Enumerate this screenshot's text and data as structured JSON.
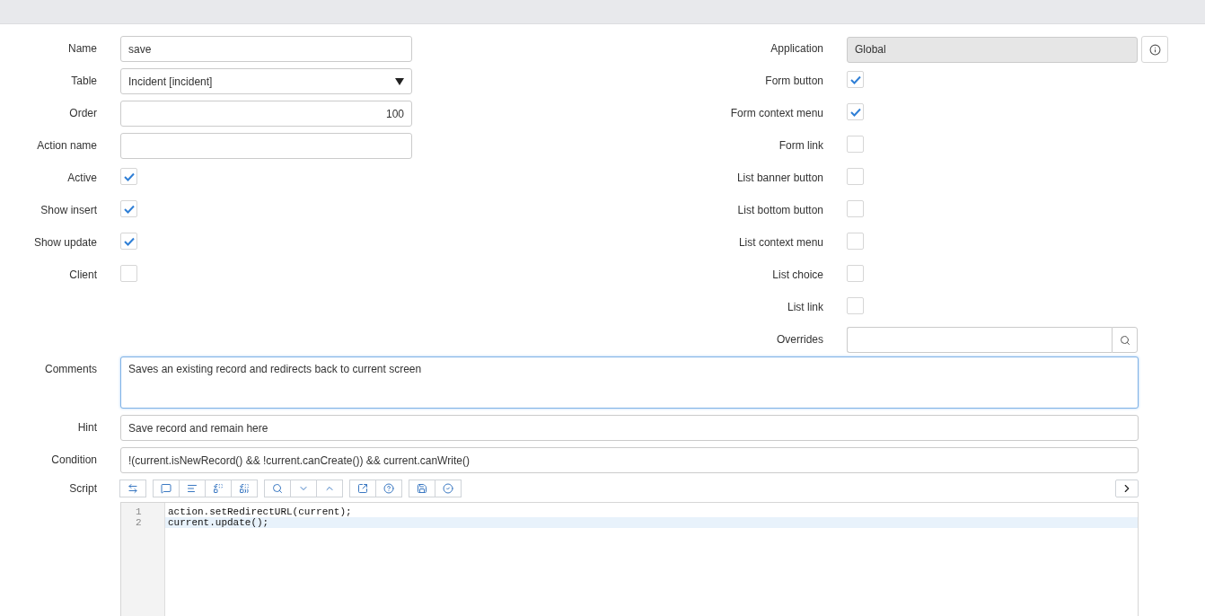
{
  "left_fields": [
    {
      "label": "Name",
      "kind": "text",
      "value": "save"
    },
    {
      "label": "Table",
      "kind": "select",
      "value": "Incident [incident]"
    },
    {
      "label": "Order",
      "kind": "number",
      "value": "100"
    },
    {
      "label": "Action name",
      "kind": "text"
    },
    {
      "label": "Active",
      "kind": "checkbox",
      "checked": true
    },
    {
      "label": "Show insert",
      "kind": "checkbox",
      "checked": true
    },
    {
      "label": "Show update",
      "kind": "checkbox",
      "checked": true
    },
    {
      "label": "Client",
      "kind": "checkbox",
      "checked": false
    }
  ],
  "right_fields": [
    {
      "label": "Application",
      "kind": "readonly",
      "value": "Global"
    },
    {
      "label": "Form button",
      "kind": "checkbox",
      "checked": true
    },
    {
      "label": "Form context menu",
      "kind": "checkbox",
      "checked": true
    },
    {
      "label": "Form link",
      "kind": "checkbox",
      "checked": false
    },
    {
      "label": "List banner button",
      "kind": "checkbox",
      "checked": false
    },
    {
      "label": "List bottom button",
      "kind": "checkbox",
      "checked": false
    },
    {
      "label": "List context menu",
      "kind": "checkbox",
      "checked": false
    },
    {
      "label": "List choice",
      "kind": "checkbox",
      "checked": false
    },
    {
      "label": "List link",
      "kind": "checkbox",
      "checked": false
    },
    {
      "label": "Overrides",
      "kind": "lookup"
    }
  ],
  "comments": {
    "label": "Comments",
    "value": "Saves an existing record and redirects back to current screen"
  },
  "hint": {
    "label": "Hint",
    "value": "Save record and remain here"
  },
  "condition": {
    "label": "Condition",
    "value": "!(current.isNewRecord() && !current.canCreate()) && current.canWrite()"
  },
  "script": {
    "label": "Script",
    "lines": [
      {
        "number": "1",
        "code": "action.setRedirectURL(current);",
        "active": false
      },
      {
        "number": "2",
        "code": "current.update();",
        "active": true
      }
    ]
  }
}
